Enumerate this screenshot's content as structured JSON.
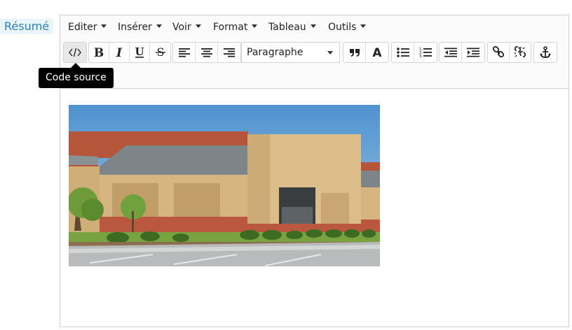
{
  "field": {
    "label": "Résumé"
  },
  "menubar": [
    {
      "label": "Editer"
    },
    {
      "label": "Insérer"
    },
    {
      "label": "Voir"
    },
    {
      "label": "Format"
    },
    {
      "label": "Tableau"
    },
    {
      "label": "Outils"
    }
  ],
  "toolbar": {
    "code_icon": "code-icon",
    "bold_icon": "bold-icon",
    "italic_icon": "italic-icon",
    "underline_icon": "underline-icon",
    "strike_icon": "strikethrough-icon",
    "format_select": {
      "value": "Paragraphe"
    }
  },
  "tooltip": {
    "text": "Code source"
  },
  "colors": {
    "label_bg": "#eaf4fb",
    "label_text": "#2f7fb5",
    "tooltip_bg": "#000000",
    "active_button": "#e8e8e8"
  }
}
